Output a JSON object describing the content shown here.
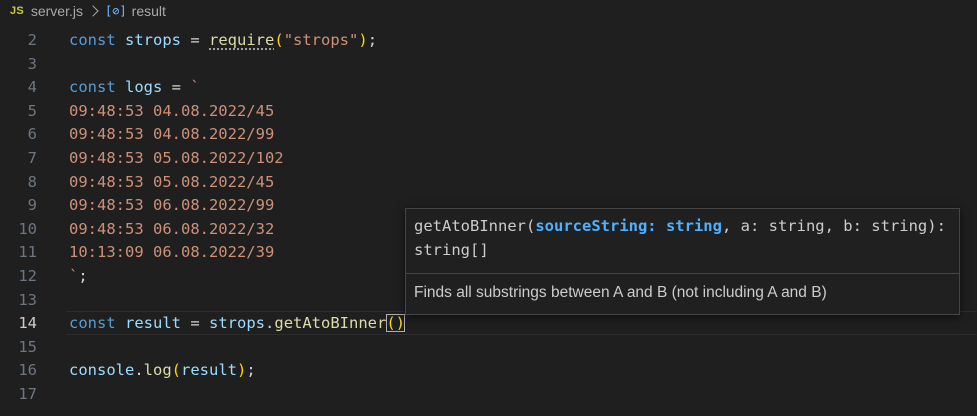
{
  "breadcrumb": {
    "file_badge": "JS",
    "file_name": "server.js",
    "symbol_icon": "[⊘]",
    "symbol_name": "result"
  },
  "editor": {
    "lines": [
      {
        "n": "2",
        "tokens": [
          [
            "kw",
            "const"
          ],
          [
            "op",
            " "
          ],
          [
            "id",
            "strops"
          ],
          [
            "op",
            " = "
          ],
          [
            "fn sq",
            "require"
          ],
          [
            "par-y",
            "("
          ],
          [
            "str",
            "\"strops\""
          ],
          [
            "par-y",
            ")"
          ],
          [
            "punc",
            ";"
          ]
        ]
      },
      {
        "n": "3",
        "tokens": []
      },
      {
        "n": "4",
        "tokens": [
          [
            "kw",
            "const"
          ],
          [
            "op",
            " "
          ],
          [
            "id",
            "logs"
          ],
          [
            "op",
            " = "
          ],
          [
            "str",
            "`"
          ]
        ]
      },
      {
        "n": "5",
        "tokens": [
          [
            "str",
            "09:48:53 04.08.2022/45"
          ]
        ]
      },
      {
        "n": "6",
        "tokens": [
          [
            "str",
            "09:48:53 04.08.2022/99"
          ]
        ]
      },
      {
        "n": "7",
        "tokens": [
          [
            "str",
            "09:48:53 05.08.2022/102"
          ]
        ]
      },
      {
        "n": "8",
        "tokens": [
          [
            "str",
            "09:48:53 05.08.2022/45"
          ]
        ]
      },
      {
        "n": "9",
        "tokens": [
          [
            "str",
            "09:48:53 06.08.2022/99"
          ]
        ]
      },
      {
        "n": "10",
        "tokens": [
          [
            "str",
            "09:48:53 06.08.2022/32"
          ]
        ]
      },
      {
        "n": "11",
        "tokens": [
          [
            "str",
            "10:13:09 06.08.2022/39"
          ]
        ]
      },
      {
        "n": "12",
        "tokens": [
          [
            "str",
            "`"
          ],
          [
            "punc",
            ";"
          ]
        ]
      },
      {
        "n": "13",
        "tokens": []
      },
      {
        "n": "14",
        "current": true,
        "tokens": [
          [
            "kw",
            "const"
          ],
          [
            "op",
            " "
          ],
          [
            "id",
            "result"
          ],
          [
            "op",
            " = "
          ],
          [
            "id",
            "strops"
          ],
          [
            "punc",
            "."
          ],
          [
            "fn",
            "getAtoBInner"
          ],
          [
            "bracket-match",
            "()"
          ]
        ]
      },
      {
        "n": "15",
        "tokens": []
      },
      {
        "n": "16",
        "tokens": [
          [
            "id",
            "console"
          ],
          [
            "punc",
            "."
          ],
          [
            "fn",
            "log"
          ],
          [
            "par-y",
            "("
          ],
          [
            "id",
            "result"
          ],
          [
            "par-y",
            ")"
          ],
          [
            "punc",
            ";"
          ]
        ]
      },
      {
        "n": "17",
        "tokens": []
      }
    ]
  },
  "hover": {
    "sig_prefix": "getAtoBInner(",
    "sig_active": "sourceString: string",
    "sig_rest": ", a: string, b: string): string[]",
    "doc": "Finds all substrings between A and B (not including A and B)"
  },
  "colors": {
    "background": "#1f1f1f",
    "keyword": "#569cd6",
    "variable": "#9cdcfe",
    "function": "#dcdcaa",
    "string": "#ce9178",
    "bracket": "#ffd700",
    "active_param": "#4fb0ff"
  }
}
